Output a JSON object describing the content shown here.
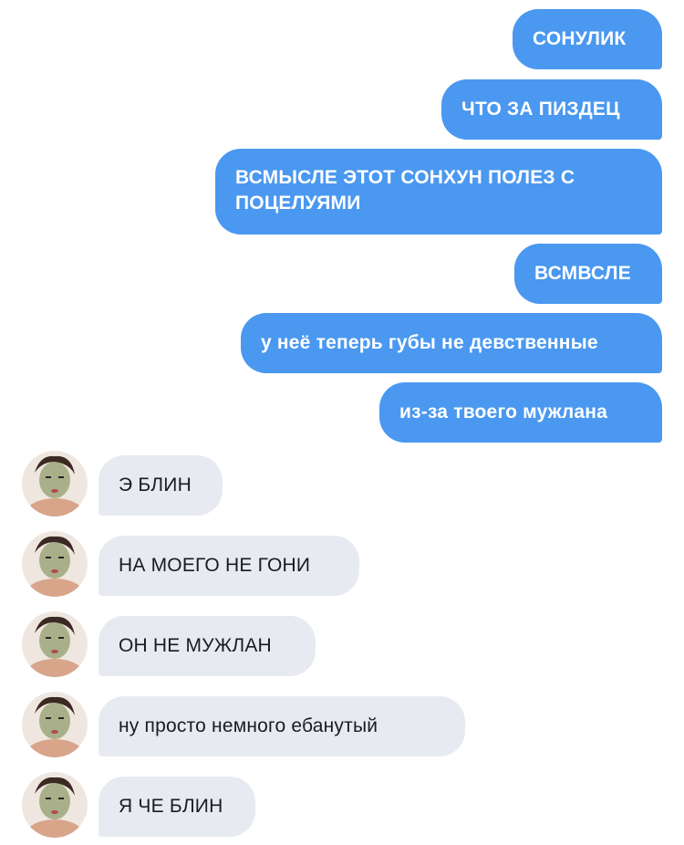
{
  "chat": {
    "outgoing": [
      {
        "text": "СОНУЛИК"
      },
      {
        "text": "ЧТО ЗА ПИЗДЕЦ"
      },
      {
        "text": "ВСМЫСЛЕ ЭТОТ СОНХУН ПОЛЕЗ С ПОЦЕЛУЯМИ"
      },
      {
        "text": "ВСМВСЛЕ"
      },
      {
        "text": "у неё теперь губы не девственные"
      },
      {
        "text": "из-за твоего мужлана"
      }
    ],
    "incoming": [
      {
        "text": "Э БЛИН"
      },
      {
        "text": "НА МОЕГО НЕ ГОНИ"
      },
      {
        "text": "ОН НЕ МУЖЛАН"
      },
      {
        "text": "ну просто немного ебанутый"
      },
      {
        "text": "Я ЧЕ БЛИН"
      }
    ]
  },
  "colors": {
    "outgoing_bubble": "#4a98f0",
    "incoming_bubble": "#e8eaf1",
    "outgoing_text": "#ffffff",
    "incoming_text": "#1b1b1f"
  },
  "icons": {
    "avatar": "sender-avatar-photo"
  }
}
